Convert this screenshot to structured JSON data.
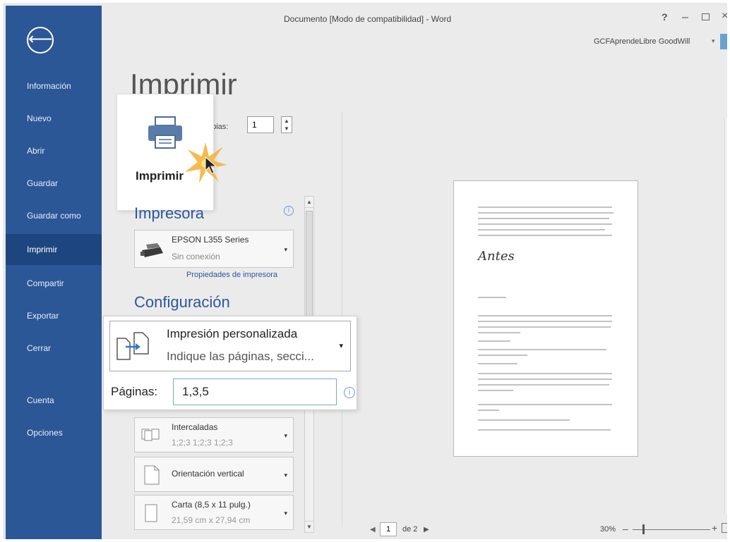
{
  "window": {
    "title": "Documento [Modo de compatibilidad] - Word",
    "help": "?",
    "minimize": "–",
    "close": "×",
    "user": "GCFAprendeLibre GoodWill",
    "user_caret": "▾"
  },
  "sidebar": {
    "back": "⟵",
    "items": [
      {
        "label": "Información"
      },
      {
        "label": "Nuevo"
      },
      {
        "label": "Abrir"
      },
      {
        "label": "Guardar"
      },
      {
        "label": "Guardar como"
      },
      {
        "label": "Imprimir"
      },
      {
        "label": "Compartir"
      },
      {
        "label": "Exportar"
      },
      {
        "label": "Cerrar"
      },
      {
        "label": "Cuenta"
      },
      {
        "label": "Opciones"
      }
    ],
    "active": "Imprimir"
  },
  "print": {
    "page_title": "Imprimir",
    "button_label": "Imprimir",
    "copies_label": "opias:",
    "copies_value": "1",
    "spin": "▲▼"
  },
  "printer": {
    "heading": "Impresora",
    "info": "i",
    "name": "EPSON L355 Series",
    "status": "Sin conexión",
    "caret": "▾",
    "properties_link": "Propiedades de impresora"
  },
  "configuration": {
    "heading": "Configuración",
    "custom_title": "Impresión personalizada",
    "custom_sub": "Indique las páginas, secci...",
    "custom_caret": "▾",
    "pages_label": "Páginas:",
    "pages_value": "1,3,5",
    "pages_info": "i",
    "collated_title": "Intercaladas",
    "collated_sub": "1;2;3   1;2;3   1;2;3",
    "orientation_title": "Orientación vertical",
    "paper_title": "Carta (8,5 x 11 pulg.)",
    "paper_sub": "21,59 cm x 27,94 cm",
    "caret": "▾"
  },
  "scroll": {
    "up": "▲",
    "down": "▼"
  },
  "preview": {
    "signature": "Antes",
    "prev": "◀",
    "current_page": "1",
    "of_label": "de 2",
    "next": "▶",
    "zoom": "30%",
    "zoom_minus": "–",
    "zoom_plus": "+"
  },
  "colors": {
    "sidebar": "#2b5797",
    "sidebar_active": "#1d457f",
    "accent": "#2b579a",
    "background": "#ebebeb"
  },
  "icons": [
    "back-arrow-icon",
    "printer-icon",
    "click-burst-icon",
    "cursor-icon",
    "printer-device-icon",
    "custom-print-icon",
    "collate-icon",
    "portrait-icon",
    "paper-size-icon",
    "info-icon"
  ]
}
